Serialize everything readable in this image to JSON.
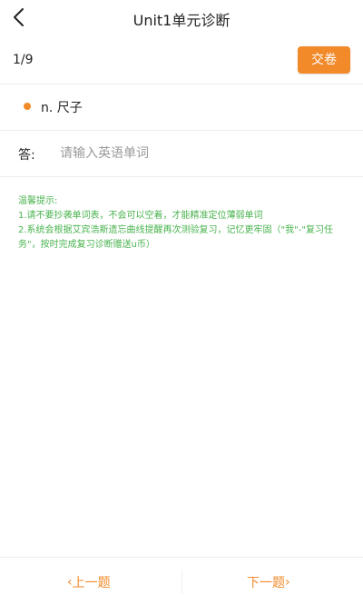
{
  "header": {
    "title": "Unit1单元诊断",
    "back_icon": "chevron-left-icon"
  },
  "progress": {
    "text": "1/9",
    "submit_label": "交卷"
  },
  "question": {
    "text": "n. 尺子"
  },
  "answer": {
    "label": "答:",
    "placeholder": "请输入英语单词",
    "value": ""
  },
  "tips": {
    "title": "温馨提示:",
    "line1": "1.请不要抄袭单词表，不会可以空着，才能精准定位薄弱单词",
    "line2": "2.系统会根据艾宾浩斯遗忘曲线提醒再次测验复习，记忆更牢固（\"我\"-\"复习任务\"，按时完成复习诊断赠送u币）"
  },
  "nav": {
    "prev_label": "上一题",
    "next_label": "下一题",
    "prev_icon": "‹",
    "next_icon": "›"
  },
  "colors": {
    "accent": "#f28a2a",
    "tip_green": "#49b34e"
  }
}
